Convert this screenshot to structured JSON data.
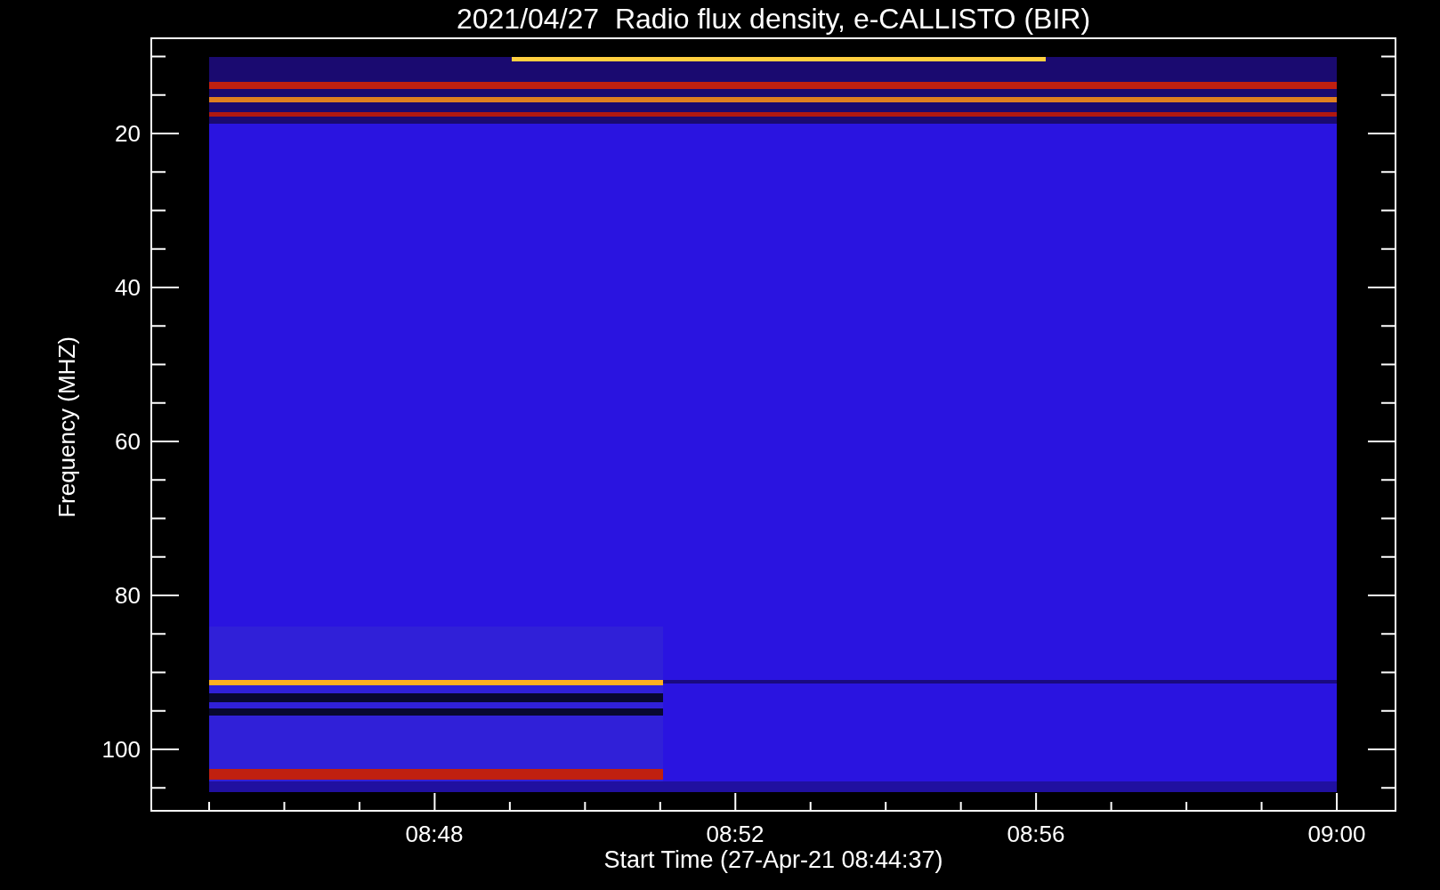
{
  "title": "2021/04/27  Radio flux density, e-CALLISTO (BIR)",
  "y_axis": {
    "label": "Frequency (MHZ)",
    "ticks": [
      "20",
      "40",
      "60",
      "80",
      "100"
    ]
  },
  "x_axis": {
    "label": "Start Time (27-Apr-21 08:44:37)",
    "ticks": [
      "08:48",
      "08:52",
      "08:56",
      "09:00"
    ]
  }
}
